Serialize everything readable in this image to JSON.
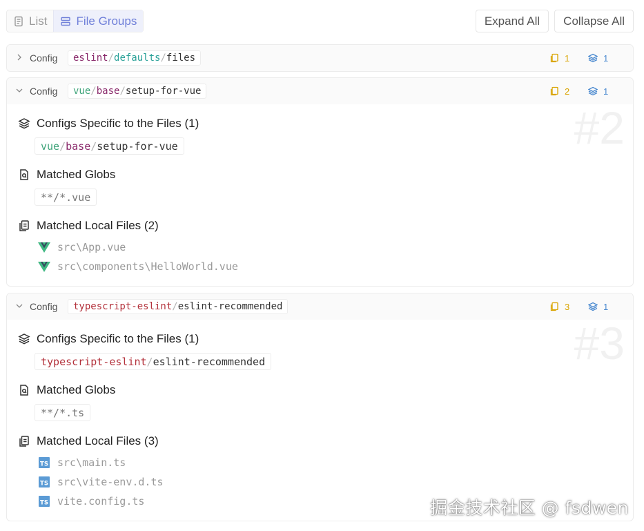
{
  "toolbar": {
    "list_label": "List",
    "file_groups_label": "File Groups",
    "expand_all": "Expand All",
    "collapse_all": "Collapse All"
  },
  "groups": [
    {
      "config_label": "Config",
      "name_parts": [
        "eslint",
        "defaults",
        "files"
      ],
      "files_count": "1",
      "configs_count": "1",
      "expanded": false
    },
    {
      "config_label": "Config",
      "name_parts": [
        "vue",
        "base",
        "setup-for-vue"
      ],
      "files_count": "2",
      "configs_count": "1",
      "expanded": true,
      "index_label": "#2",
      "configs_title": "Configs Specific to the Files (1)",
      "globs_title": "Matched Globs",
      "glob": "**/*.vue",
      "local_files_title": "Matched Local Files (2)",
      "local_files": [
        "src\\App.vue",
        "src\\components\\HelloWorld.vue"
      ],
      "file_icon": "vue-logo-icon"
    },
    {
      "config_label": "Config",
      "name_parts": [
        "typescript-eslint",
        "eslint-recommended"
      ],
      "files_count": "3",
      "configs_count": "1",
      "expanded": true,
      "index_label": "#3",
      "configs_title": "Configs Specific to the Files (1)",
      "globs_title": "Matched Globs",
      "glob": "**/*.ts",
      "local_files_title": "Matched Local Files (3)",
      "local_files": [
        "src\\main.ts",
        "src\\vite-env.d.ts",
        "vite.config.ts"
      ],
      "file_icon": "typescript-icon"
    }
  ],
  "sep": "/",
  "watermark": "掘金技术社区 @ fsdwen",
  "colors": {
    "accent": "#6f7fd9",
    "files_stat": "#d9a400",
    "configs_stat": "#4b8ad0",
    "vue_green": "#41b883",
    "ts_blue": "#5b9bd5"
  }
}
